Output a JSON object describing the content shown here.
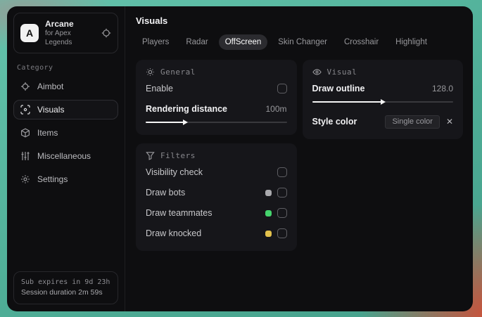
{
  "app": {
    "logo_letter": "A",
    "name": "Arcane",
    "subtitle": "for Apex Legends"
  },
  "sidebar": {
    "category_label": "Category",
    "items": [
      {
        "label": "Aimbot"
      },
      {
        "label": "Visuals"
      },
      {
        "label": "Items"
      },
      {
        "label": "Miscellaneous"
      },
      {
        "label": "Settings"
      }
    ],
    "footer": {
      "line1": "Sub expires in 9d 23h",
      "line2": "Session duration 2m 59s"
    }
  },
  "header": {
    "title": "Visuals"
  },
  "tabs": [
    {
      "label": "Players"
    },
    {
      "label": "Radar"
    },
    {
      "label": "OffScreen"
    },
    {
      "label": "Skin Changer"
    },
    {
      "label": "Crosshair"
    },
    {
      "label": "Highlight"
    }
  ],
  "panels": {
    "general": {
      "title": "General",
      "enable_label": "Enable",
      "rendering": {
        "label": "Rendering distance",
        "value": "100m",
        "percent": 27
      }
    },
    "visual": {
      "title": "Visual",
      "outline": {
        "label": "Draw outline",
        "value": "128.0",
        "percent": 49
      },
      "style_color": {
        "label": "Style color",
        "selected_option": "Single color",
        "clear_glyph": "✕"
      }
    },
    "filters": {
      "title": "Filters",
      "rows": [
        {
          "label": "Visibility check",
          "swatch": ""
        },
        {
          "label": "Draw bots",
          "swatch": "#a9a9ad"
        },
        {
          "label": "Draw teammates",
          "swatch": "#45d46d"
        },
        {
          "label": "Draw knocked",
          "swatch": "#e2c14c"
        }
      ]
    }
  },
  "colors": {
    "backdrop_teal": "#4fae97",
    "backdrop_red": "#cf4f38",
    "window_bg": "#0e0e10",
    "panel_bg": "#16161a",
    "accent_white": "#f5f5f5"
  }
}
